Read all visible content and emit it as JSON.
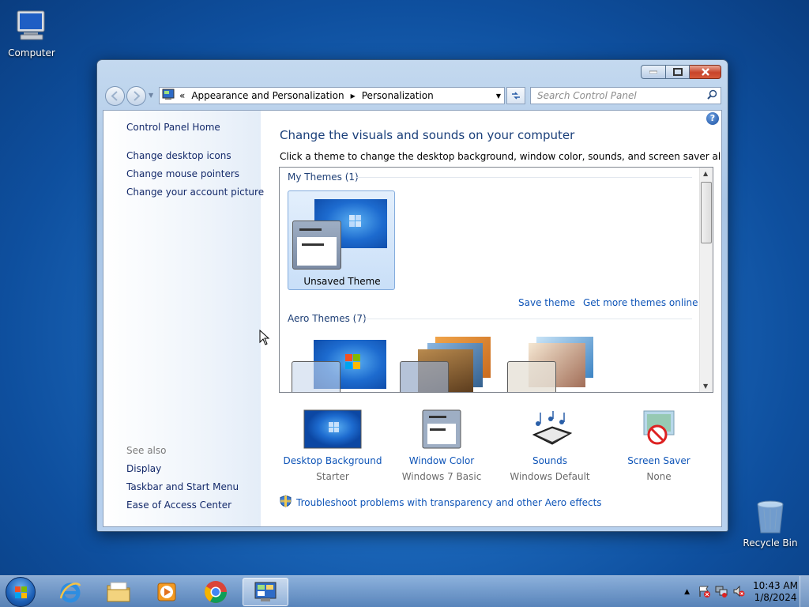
{
  "desktop": {
    "computer_label": "Computer",
    "recycle_label": "Recycle Bin"
  },
  "window": {
    "breadcrumb_prefix": "«",
    "breadcrumb": [
      "Appearance and Personalization",
      "Personalization"
    ],
    "search_placeholder": "Search Control Panel"
  },
  "left_pane": {
    "home": "Control Panel Home",
    "tasks": [
      "Change desktop icons",
      "Change mouse pointers",
      "Change your account picture"
    ],
    "see_also_heading": "See also",
    "see_also": [
      "Display",
      "Taskbar and Start Menu",
      "Ease of Access Center"
    ]
  },
  "main": {
    "title": "Change the visuals and sounds on your computer",
    "subtitle": "Click a theme to change the desktop background, window color, sounds, and screen saver all at once.",
    "my_themes_heading": "My Themes (1)",
    "unsaved_theme": "Unsaved Theme",
    "save_theme": "Save theme",
    "get_more": "Get more themes online",
    "aero_heading": "Aero Themes (7)",
    "bottom": [
      {
        "label": "Desktop Background",
        "value": "Starter"
      },
      {
        "label": "Window Color",
        "value": "Windows 7 Basic"
      },
      {
        "label": "Sounds",
        "value": "Windows Default"
      },
      {
        "label": "Screen Saver",
        "value": "None"
      }
    ],
    "troubleshoot": "Troubleshoot problems with transparency and other Aero effects"
  },
  "taskbar": {
    "time": "10:43 AM",
    "date": "1/8/2024"
  },
  "colors": {
    "link": "#0f55b8",
    "nav_link": "#13296a",
    "title": "#1a3f7a"
  }
}
